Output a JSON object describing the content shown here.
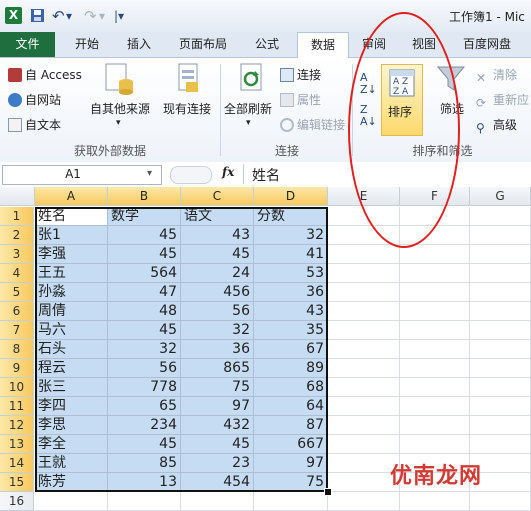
{
  "window": {
    "title": "工作簿1 - Mic",
    "app_icon": "X"
  },
  "quick_access": {
    "save": "save-icon",
    "undo": "↶",
    "redo": "↷",
    "customize": "▾"
  },
  "ribbon_tabs": [
    "文件",
    "开始",
    "插入",
    "页面布局",
    "公式",
    "数据",
    "审阅",
    "视图",
    "百度网盘"
  ],
  "active_tab": "数据",
  "ribbon": {
    "external": {
      "access": "自 Access",
      "web": "自网站",
      "text": "自文本",
      "other_sources": "自其他来源",
      "existing": "现有连接",
      "group_label": "获取外部数据"
    },
    "connections": {
      "refresh_all": "全部刷新",
      "connections": "连接",
      "properties": "属性",
      "edit_links": "编辑链接",
      "group_label": "连接"
    },
    "sort_filter": {
      "sort": "排序",
      "filter": "筛选",
      "clear": "清除",
      "reapply": "重新应",
      "advanced": "高级",
      "group_label": "排序和筛选"
    }
  },
  "formula_bar": {
    "name_box": "A1",
    "fx": "fx",
    "formula": "姓名"
  },
  "grid": {
    "columns": [
      "A",
      "B",
      "C",
      "D",
      "E",
      "F",
      "G"
    ],
    "rows": [
      "1",
      "2",
      "3",
      "4",
      "5",
      "6",
      "7",
      "8",
      "9",
      "10",
      "11",
      "12",
      "13",
      "14",
      "15",
      "16"
    ],
    "data": [
      [
        "姓名",
        "数学",
        "语文",
        "分数"
      ],
      [
        "张1",
        "45",
        "43",
        "32"
      ],
      [
        "李强",
        "45",
        "45",
        "41"
      ],
      [
        "王五",
        "564",
        "24",
        "53"
      ],
      [
        "孙淼",
        "47",
        "456",
        "36"
      ],
      [
        "周倩",
        "48",
        "56",
        "43"
      ],
      [
        "马六",
        "45",
        "32",
        "35"
      ],
      [
        "石头",
        "32",
        "36",
        "67"
      ],
      [
        "程云",
        "56",
        "865",
        "89"
      ],
      [
        "张三",
        "778",
        "75",
        "68"
      ],
      [
        "李四",
        "65",
        "97",
        "64"
      ],
      [
        "李思",
        "234",
        "432",
        "87"
      ],
      [
        "李全",
        "45",
        "45",
        "667"
      ],
      [
        "王就",
        "85",
        "23",
        "97"
      ],
      [
        "陈芳",
        "13",
        "454",
        "75"
      ]
    ]
  },
  "watermark": "优南龙网",
  "colors": {
    "file_tab": "#1f6e3e",
    "selection": "#c5dcf3",
    "annotation": "#e0201e",
    "header_selected": "#f8c95d"
  }
}
